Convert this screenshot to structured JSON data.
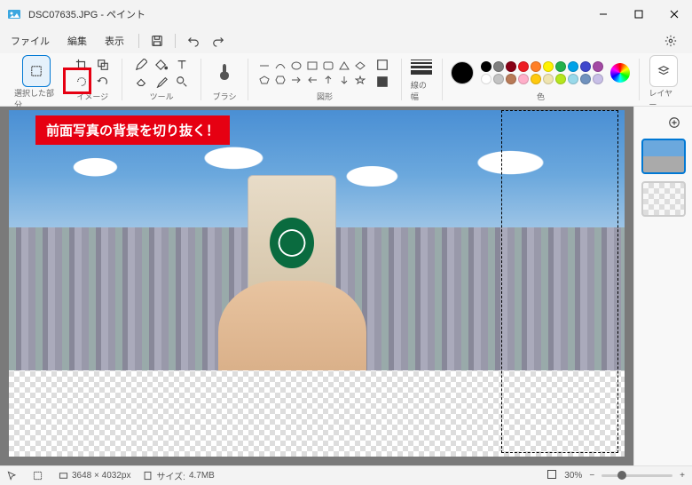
{
  "window": {
    "title": "DSC07635.JPG - ペイント"
  },
  "menu": {
    "file": "ファイル",
    "edit": "編集",
    "view": "表示"
  },
  "ribbon": {
    "selection_label": "選択した部分",
    "image_label": "イメージ",
    "tools_label": "ツール",
    "brushes_label": "ブラシ",
    "shapes_label": "図形",
    "stroke_label": "線の幅",
    "colors_label": "色",
    "layers_label": "レイヤー"
  },
  "annotation": {
    "text": "前面写真の背景を切り抜く！"
  },
  "colors": {
    "current": "#000000",
    "palette": [
      "#000000",
      "#7f7f7f",
      "#880015",
      "#ed1c24",
      "#ff7f27",
      "#fff200",
      "#22b14c",
      "#00a2e8",
      "#3f48cc",
      "#a349a4",
      "#ffffff",
      "#c3c3c3",
      "#b97a57",
      "#ffaec9",
      "#ffc90e",
      "#efe4b0",
      "#b5e61d",
      "#99d9ea",
      "#7092be",
      "#c8bfe7"
    ]
  },
  "status": {
    "dimensions": "3648 × 4032px",
    "size_label": "サイズ:",
    "size_value": "4.7MB",
    "zoom": "30%"
  }
}
